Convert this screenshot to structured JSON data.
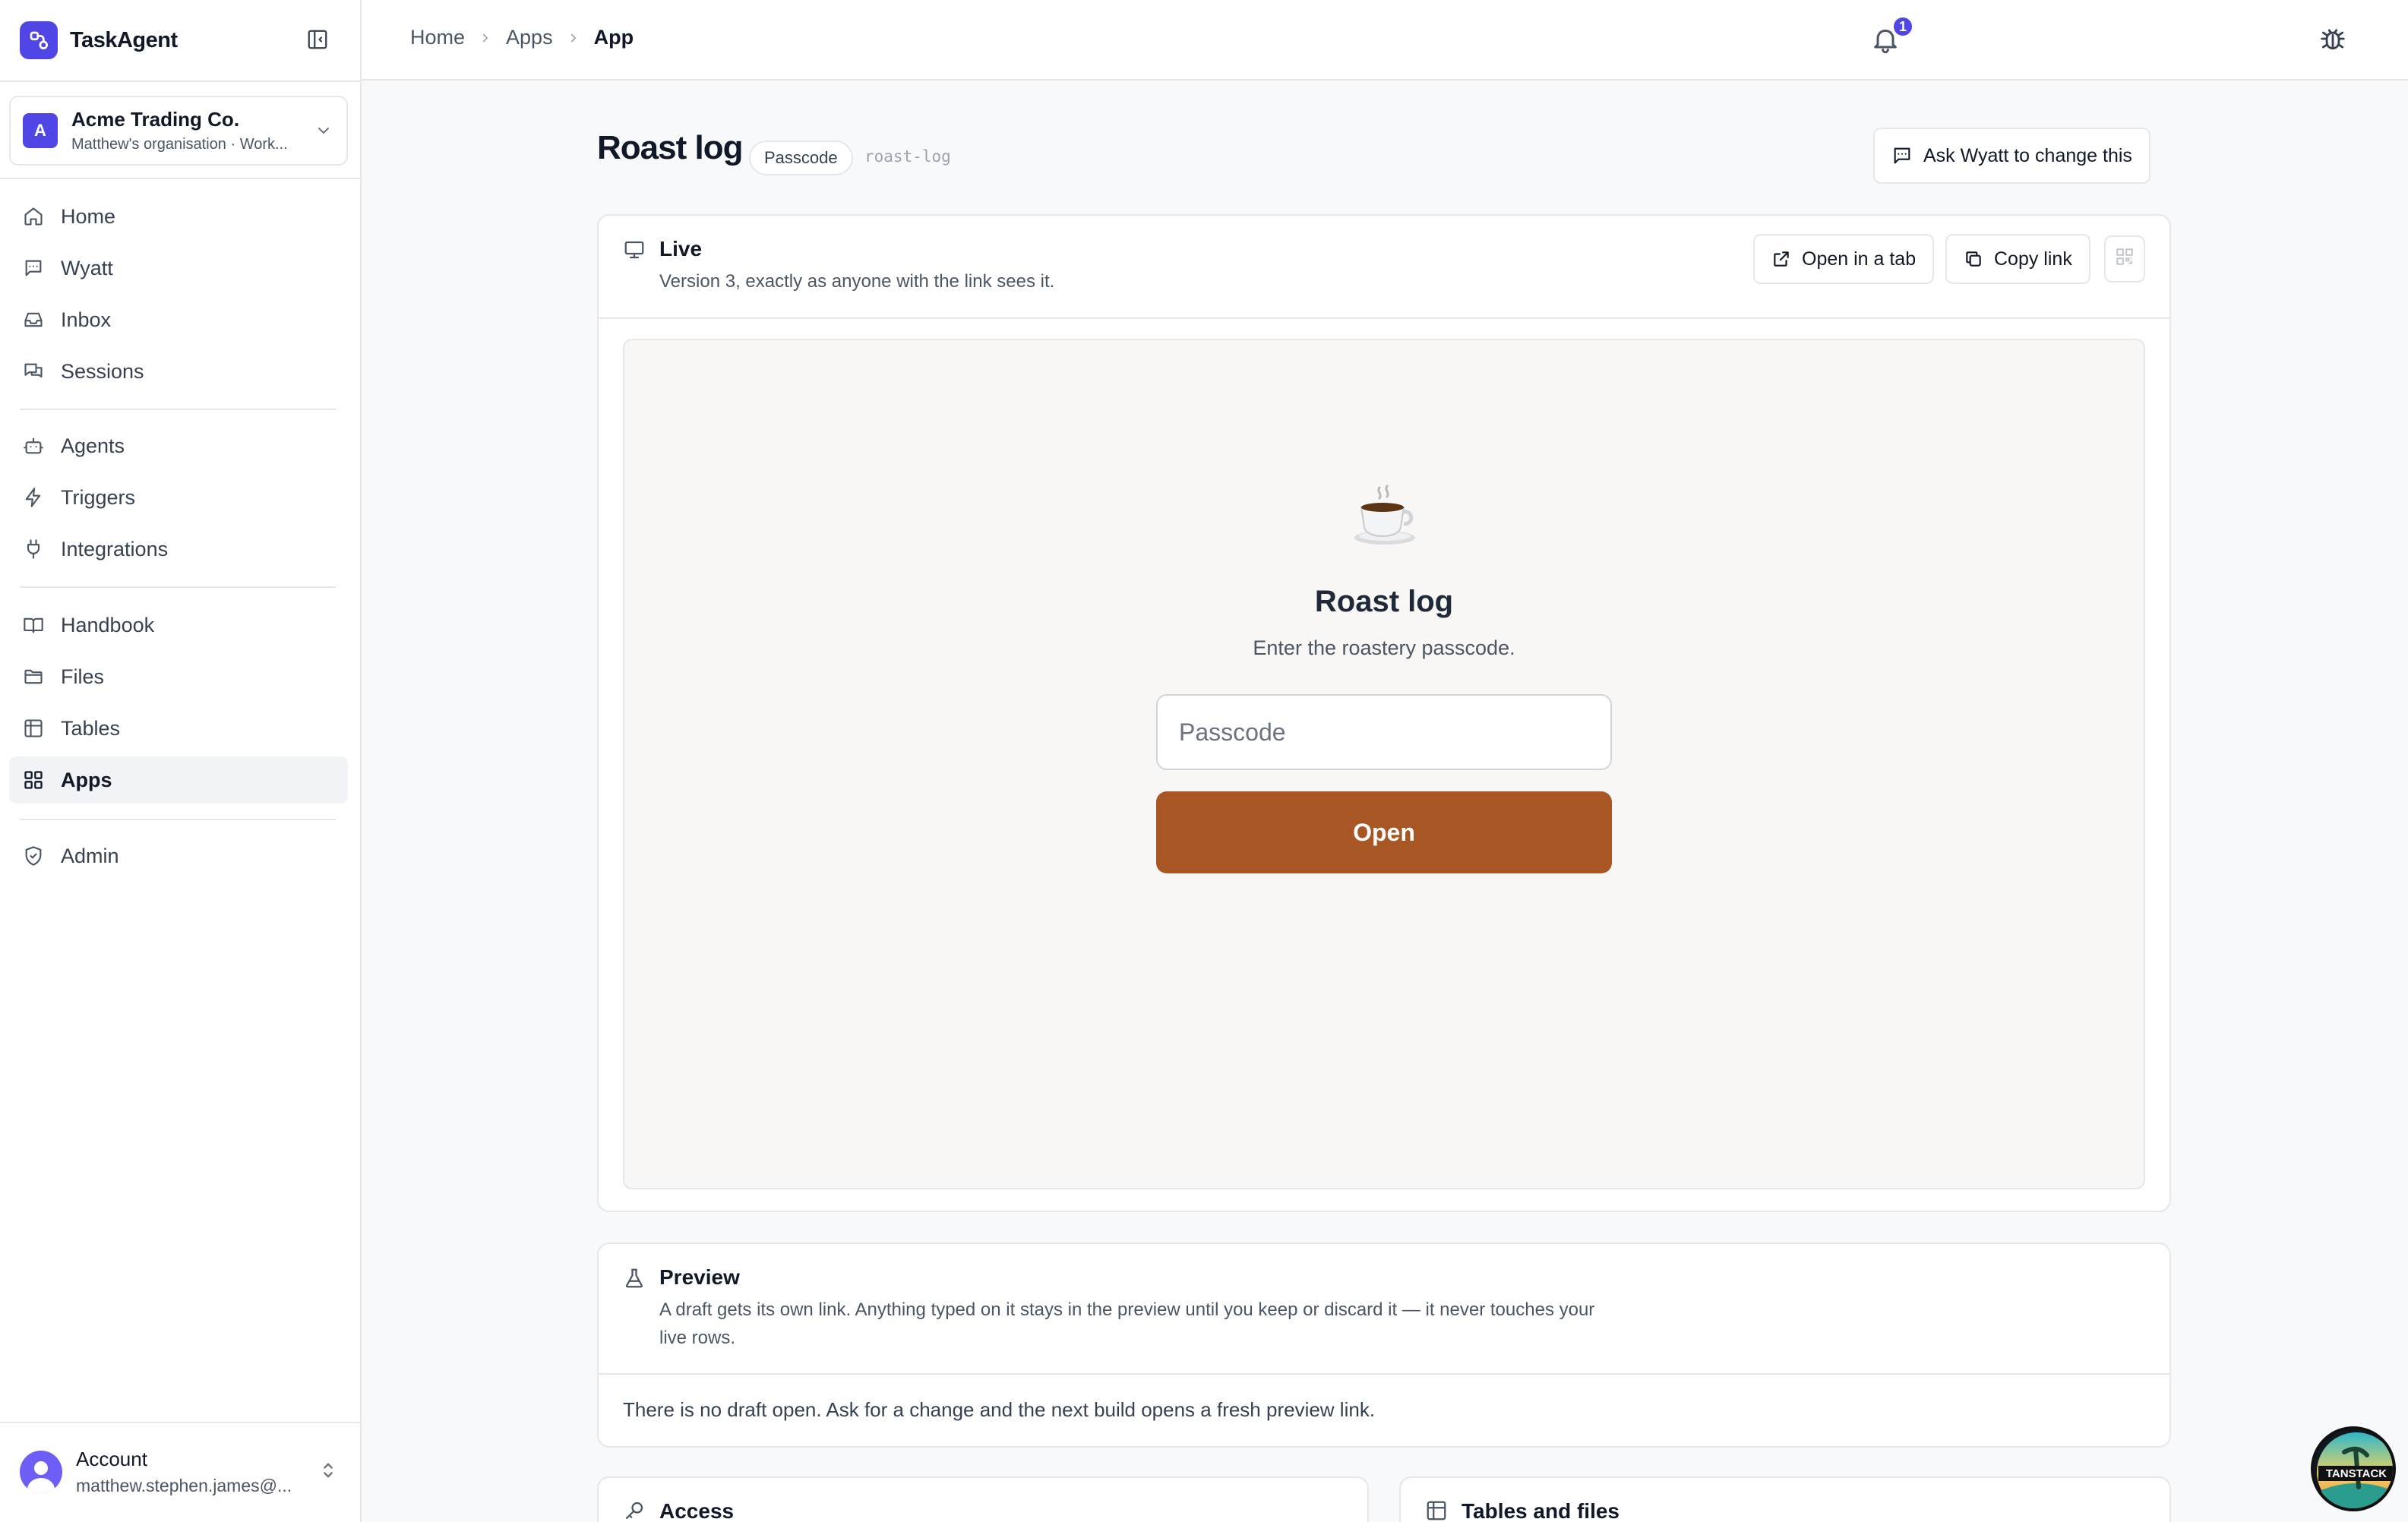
{
  "app": {
    "name": "TaskAgent"
  },
  "org": {
    "initial": "A",
    "name": "Acme Trading Co.",
    "subtitle": "Matthew's organisation · Work..."
  },
  "nav": {
    "home": "Home",
    "wyatt": "Wyatt",
    "inbox": "Inbox",
    "sessions": "Sessions",
    "agents": "Agents",
    "triggers": "Triggers",
    "integrations": "Integrations",
    "handbook": "Handbook",
    "files": "Files",
    "tables": "Tables",
    "apps": "Apps",
    "admin": "Admin"
  },
  "account": {
    "label": "Account",
    "email": "matthew.stephen.james@..."
  },
  "breadcrumb": [
    "Home",
    "Apps",
    "App"
  ],
  "notifications": {
    "count": "1"
  },
  "page": {
    "title": "Roast log",
    "badge": "Passcode",
    "slug": "roast-log",
    "ask_button": "Ask Wyatt to change this"
  },
  "live": {
    "title": "Live",
    "subtitle": "Version 3, exactly as anyone with the link sees it.",
    "open_tab": "Open in a tab",
    "copy_link": "Copy link"
  },
  "app_preview": {
    "emoji": "☕",
    "title": "Roast log",
    "subtitle": "Enter the roastery passcode.",
    "input_placeholder": "Passcode",
    "button": "Open",
    "accent": "#a85624"
  },
  "preview": {
    "title": "Preview",
    "description": "A draft gets its own link. Anything typed on it stays in the preview until you keep or discard it — it never touches your live rows.",
    "empty": "There is no draft open. Ask for a change and the next build opens a fresh preview link."
  },
  "access": {
    "title": "Access"
  },
  "tables_files": {
    "title": "Tables and files"
  },
  "colors": {
    "brand": "#4f46e5",
    "accent": "#a85624"
  }
}
